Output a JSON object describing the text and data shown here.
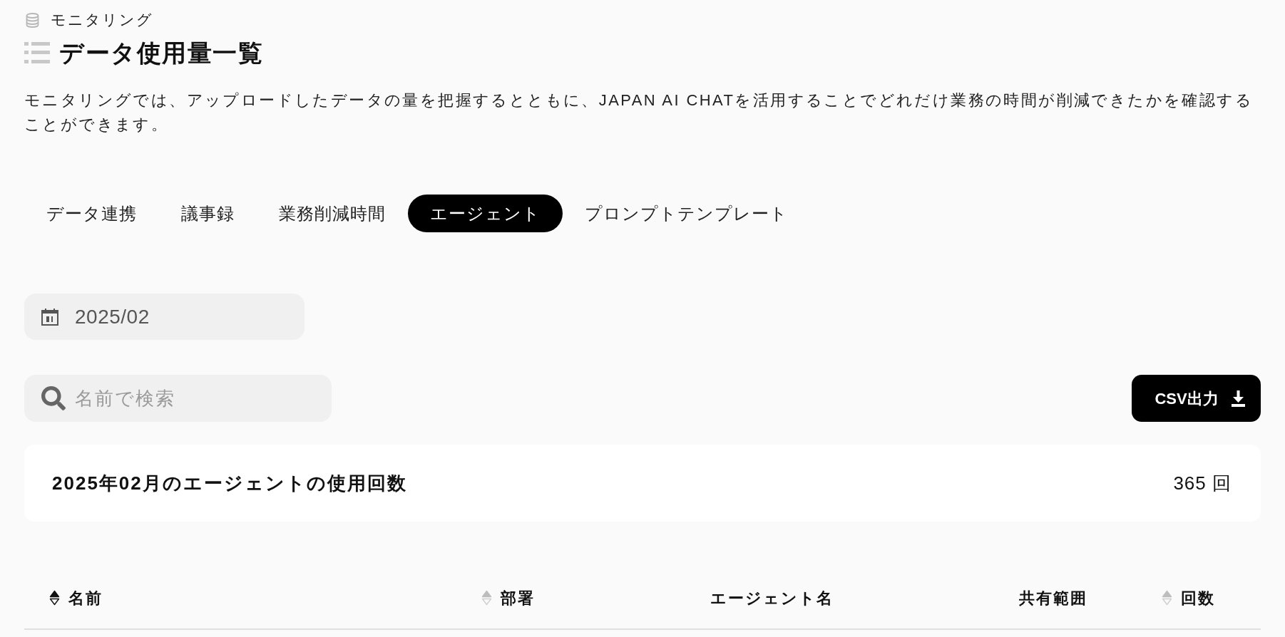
{
  "breadcrumb": {
    "label": "モニタリング"
  },
  "page_title": "データ使用量一覧",
  "description": "モニタリングでは、アップロードしたデータの量を把握するとともに、JAPAN AI CHATを活用することでどれだけ業務の時間が削減できたかを確認することができます。",
  "tabs": [
    {
      "label": "データ連携",
      "selected": false
    },
    {
      "label": "議事録",
      "selected": false
    },
    {
      "label": "業務削減時間",
      "selected": false
    },
    {
      "label": "エージェント",
      "selected": true
    },
    {
      "label": "プロンプトテンプレート",
      "selected": false
    }
  ],
  "month_field": {
    "value": "2025/02"
  },
  "search": {
    "placeholder": "名前で検索"
  },
  "export_button": {
    "label": "CSV出力"
  },
  "summary": {
    "label": "2025年02月のエージェントの使用回数",
    "value": "365 回"
  },
  "table": {
    "columns": [
      {
        "label": "名前",
        "sortable": true,
        "sorted": true
      },
      {
        "label": "部署",
        "sortable": true,
        "sorted": false
      },
      {
        "label": "エージェント名",
        "sortable": false
      },
      {
        "label": "共有範囲",
        "sortable": false
      },
      {
        "label": "回数",
        "sortable": true,
        "sorted": false
      }
    ]
  }
}
